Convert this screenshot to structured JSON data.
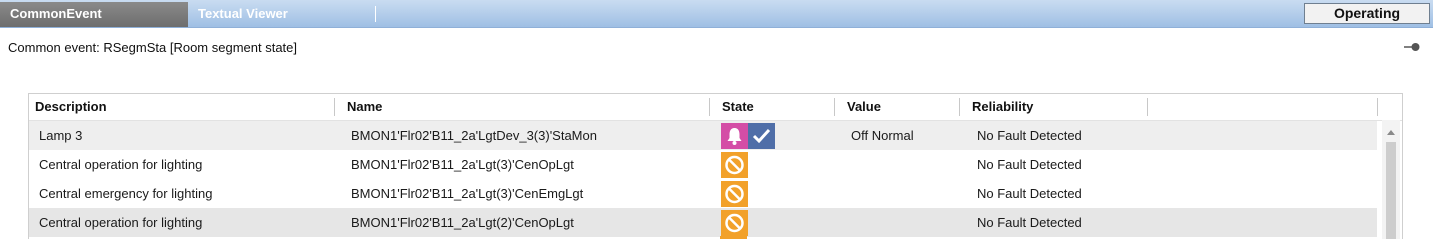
{
  "tabs": {
    "active_label": "CommonEvent",
    "inactive_label": "Textual Viewer",
    "mode_button": "Operating"
  },
  "event": {
    "title": "Common event: RSegmSta [Room segment state]"
  },
  "grid": {
    "columns": {
      "description": "Description",
      "name": "Name",
      "state": "State",
      "value": "Value",
      "reliability": "Reliability"
    },
    "rows": [
      {
        "description": "Lamp 3",
        "name": "BMON1'Flr02'B11_2a'LgtDev_3(3)'StaMon",
        "state_icons": [
          "bell-alarm-icon",
          "checkmark-icon"
        ],
        "value": "Off Normal",
        "reliability": "No Fault Detected"
      },
      {
        "description": "Central operation for lighting",
        "name": "BMON1'Flr02'B11_2a'Lgt(3)'CenOpLgt",
        "state_icons": [
          "blocked-icon"
        ],
        "value": "",
        "reliability": "No Fault Detected"
      },
      {
        "description": "Central emergency for lighting",
        "name": "BMON1'Flr02'B11_2a'Lgt(3)'CenEmgLgt",
        "state_icons": [
          "blocked-icon"
        ],
        "value": "",
        "reliability": "No Fault Detected"
      },
      {
        "description": "Central operation for lighting",
        "name": "BMON1'Flr02'B11_2a'Lgt(2)'CenOpLgt",
        "state_icons": [
          "blocked-icon"
        ],
        "value": "",
        "reliability": "No Fault Detected"
      }
    ]
  },
  "colors": {
    "alarm": "#d44da6",
    "acknowledged": "#4f6ea8",
    "blocked": "#f2a12a"
  }
}
